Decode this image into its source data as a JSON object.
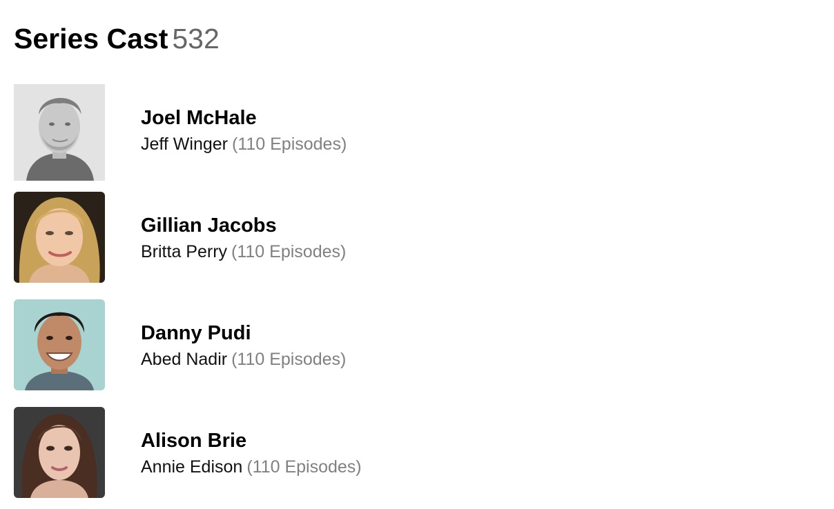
{
  "header": {
    "title": "Series Cast",
    "count": "532"
  },
  "cast": [
    {
      "actor": "Joel McHale",
      "character": "Jeff Winger",
      "episodes": "(110 Episodes)",
      "photo_bg": "#e3e3e3",
      "photo_icon": "person-photo-icon"
    },
    {
      "actor": "Gillian Jacobs",
      "character": "Britta Perry",
      "episodes": "(110 Episodes)",
      "photo_bg": "#2a2118",
      "photo_icon": "person-photo-icon"
    },
    {
      "actor": "Danny Pudi",
      "character": "Abed Nadir",
      "episodes": "(110 Episodes)",
      "photo_bg": "#a9d3d1",
      "photo_icon": "person-photo-icon"
    },
    {
      "actor": "Alison Brie",
      "character": "Annie Edison",
      "episodes": "(110 Episodes)",
      "photo_bg": "#3b3b3b",
      "photo_icon": "person-photo-icon"
    }
  ]
}
